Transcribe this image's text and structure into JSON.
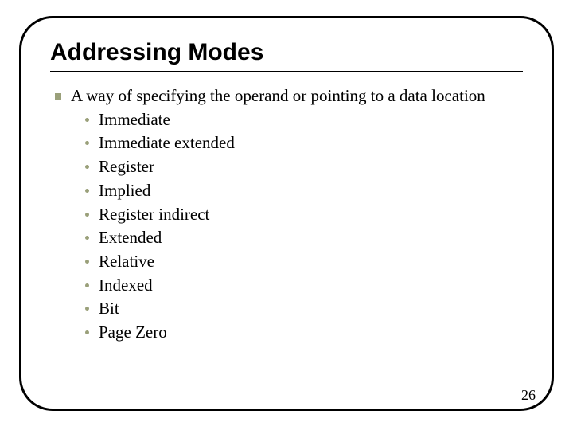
{
  "title": "Addressing Modes",
  "lead": "A way of specifying the operand or pointing to a data location",
  "items": [
    "Immediate",
    "Immediate extended",
    "Register",
    "Implied",
    "Register indirect",
    "Extended",
    "Relative",
    "Indexed",
    "Bit",
    "Page Zero"
  ],
  "page_number": "26"
}
